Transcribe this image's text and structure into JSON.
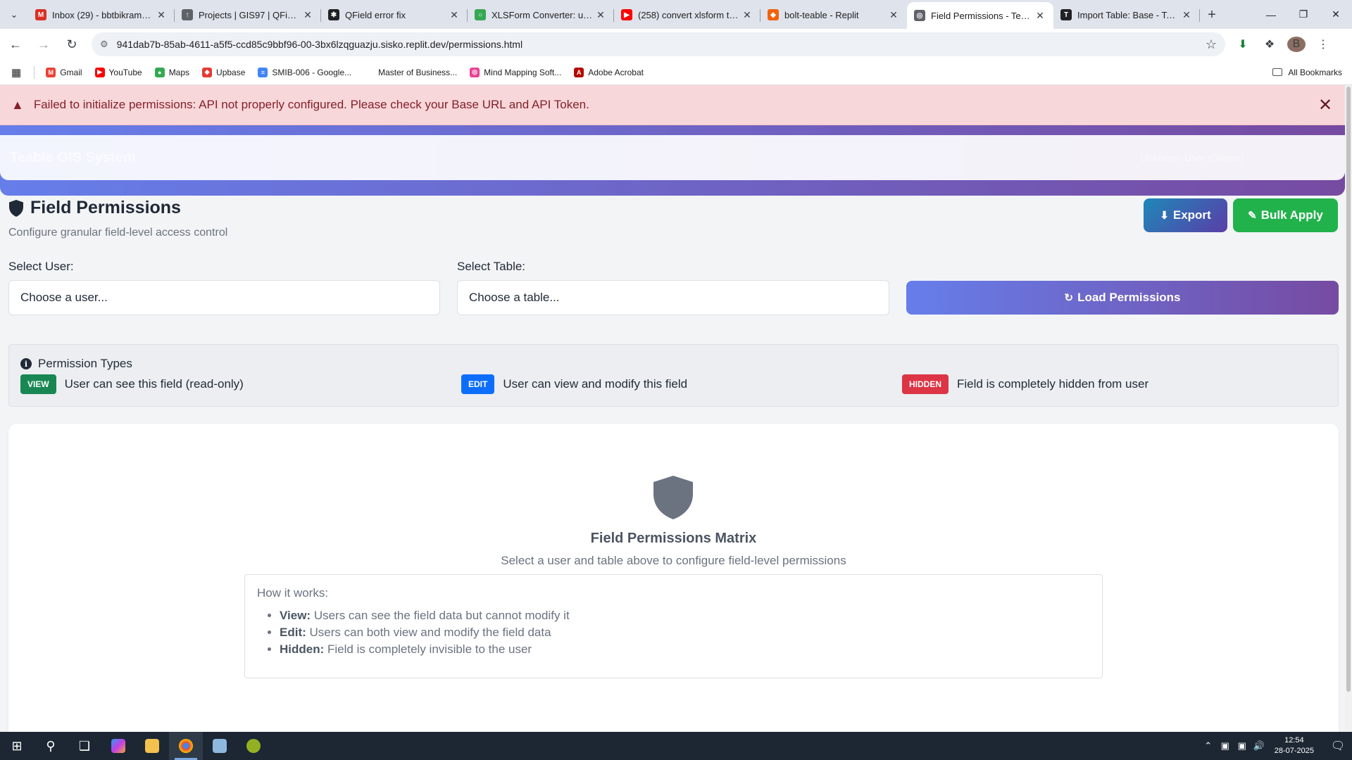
{
  "browser": {
    "tabs": [
      {
        "title": "Inbox (29) - bbtbikram@g",
        "icon_color": "#d93025",
        "icon_glyph": "M",
        "active": false
      },
      {
        "title": "Projects | GIS97 | QFieldCl",
        "icon_color": "#5f6368",
        "icon_glyph": "↑",
        "active": false
      },
      {
        "title": "QField error fix",
        "icon_color": "#202124",
        "icon_glyph": "✱",
        "active": false
      },
      {
        "title": "XLSForm Converter: unloc",
        "icon_color": "#34a853",
        "icon_glyph": "○",
        "active": false
      },
      {
        "title": "(258) convert xlsform to q",
        "icon_color": "#ff0000",
        "icon_glyph": "▶",
        "active": false
      },
      {
        "title": "bolt-teable - Replit",
        "icon_color": "#f26207",
        "icon_glyph": "◆",
        "active": false
      },
      {
        "title": "Field Permissions - Teable",
        "icon_color": "#5f6368",
        "icon_glyph": "◎",
        "active": true
      },
      {
        "title": "Import Table: Base - Teabl",
        "icon_color": "#202124",
        "icon_glyph": "T",
        "active": false
      }
    ],
    "url": "941dab7b-85ab-4611-a5f5-ccd85c9bbf96-00-3bx6lzqguazju.sisko.replit.dev/permissions.html",
    "profile_initial": "B",
    "bookmarks": [
      {
        "label": "Gmail",
        "color": "#ea4335",
        "glyph": "M"
      },
      {
        "label": "YouTube",
        "color": "#ff0000",
        "glyph": "▶"
      },
      {
        "label": "Maps",
        "color": "#34a853",
        "glyph": "●"
      },
      {
        "label": "Upbase",
        "color": "#e53935",
        "glyph": "◆"
      },
      {
        "label": "SMIB-006 - Google...",
        "color": "#4285f4",
        "glyph": "≡"
      },
      {
        "label": "Master of Business...",
        "color": "#ffffff",
        "glyph": ""
      },
      {
        "label": "Mind Mapping Soft...",
        "color": "#e84393",
        "glyph": "◎"
      },
      {
        "label": "Adobe Acrobat",
        "color": "#b30b00",
        "glyph": "A"
      }
    ],
    "all_bookmarks": "All Bookmarks"
  },
  "alert": {
    "message": "Failed to initialize permissions: API not properly configured. Please check your Base URL and API Token."
  },
  "app": {
    "brand": "Teable GIS System",
    "user": "Unknown User (Owner)"
  },
  "header": {
    "title": "Field Permissions",
    "subtitle": "Configure granular field-level access control",
    "export_label": "Export",
    "bulk_label": "Bulk Apply"
  },
  "filters": {
    "user_label": "Select User:",
    "user_placeholder": "Choose a user...",
    "table_label": "Select Table:",
    "table_placeholder": "Choose a table...",
    "load_label": "Load Permissions"
  },
  "permission_types": {
    "title": "Permission Types",
    "items": [
      {
        "badge": "VIEW",
        "color": "#198754",
        "desc": "User can see this field (read-only)"
      },
      {
        "badge": "EDIT",
        "color": "#0d6efd",
        "desc": "User can view and modify this field"
      },
      {
        "badge": "HIDDEN",
        "color": "#dc3545",
        "desc": "Field is completely hidden from user"
      }
    ]
  },
  "matrix": {
    "title": "Field Permissions Matrix",
    "subtitle": "Select a user and table above to configure field-level permissions",
    "how_title": "How it works:",
    "points": [
      {
        "term": "View:",
        "text": " Users can see the field data but cannot modify it"
      },
      {
        "term": "Edit:",
        "text": " Users can both view and modify the field data"
      },
      {
        "term": "Hidden:",
        "text": " Field is completely invisible to the user"
      }
    ]
  },
  "taskbar": {
    "time": "12:54",
    "date": "28-07-2025"
  }
}
